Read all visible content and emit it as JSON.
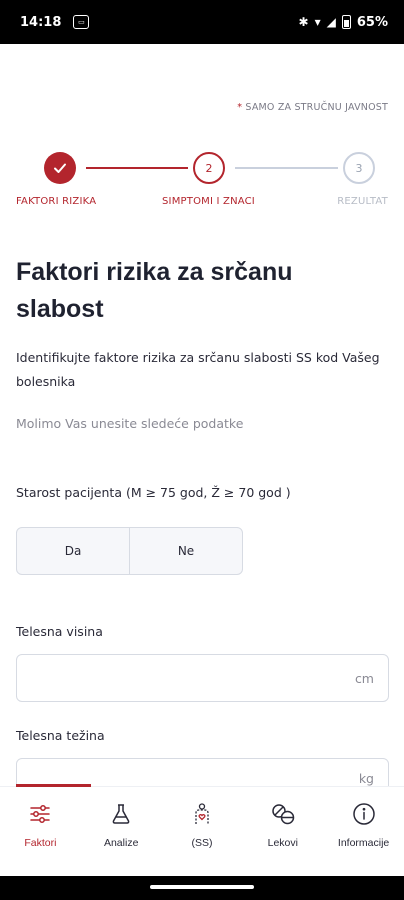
{
  "status_bar": {
    "time": "14:18",
    "sim_label": "SIM",
    "battery": "65%"
  },
  "notice": {
    "star": "*",
    "text": "SAMO ZA STRUČNU JAVNOST"
  },
  "stepper": {
    "steps": [
      {
        "number": "",
        "label": "FAKTORI RIZIKA",
        "state": "done"
      },
      {
        "number": "2",
        "label": "SIMPTOMI I ZNACI",
        "state": "current"
      },
      {
        "number": "3",
        "label": "REZULTAT",
        "state": "pending"
      }
    ]
  },
  "title": "Faktori rizika za srčanu slabost",
  "intro": "Identifikujte faktore rizika za srčanu slabosti SS kod Vašeg bolesnika",
  "hint": "Molimo Vas unesite sledeće podatke",
  "age_question": {
    "label": "Starost pacijenta (M ≥ 75 god, Ž ≥ 70 god )",
    "options": [
      "Da",
      "Ne"
    ]
  },
  "height_field": {
    "label": "Telesna visina",
    "value": "",
    "unit": "cm"
  },
  "weight_field": {
    "label": "Telesna težina",
    "value": "",
    "unit": "kg"
  },
  "bottom_nav": {
    "items": [
      {
        "label": "Faktori",
        "icon": "sliders-icon",
        "active": true
      },
      {
        "label": "Analize",
        "icon": "flask-icon",
        "active": false
      },
      {
        "label": "(SS)",
        "icon": "body-heart-icon",
        "active": false
      },
      {
        "label": "Lekovi",
        "icon": "pills-icon",
        "active": false
      },
      {
        "label": "Informacije",
        "icon": "info-icon",
        "active": false
      }
    ]
  },
  "colors": {
    "accent": "#b3252d",
    "inactive": "#c9d0dd"
  }
}
